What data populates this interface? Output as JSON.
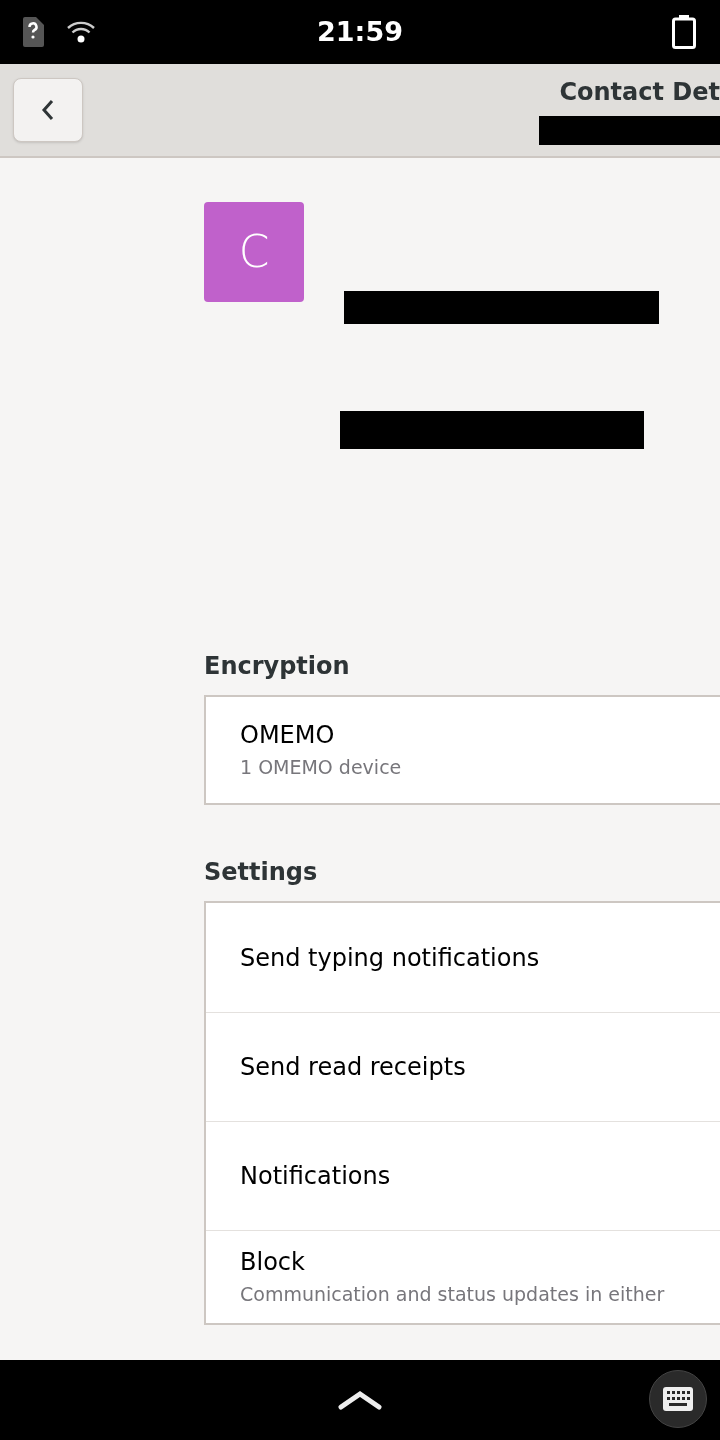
{
  "status_bar": {
    "time": "21:59"
  },
  "header": {
    "title": "Contact Det"
  },
  "contact": {
    "avatar_letter": "C"
  },
  "sections": [
    {
      "heading": "Encryption",
      "rows": [
        {
          "title": "OMEMO",
          "subtitle": "1 OMEMO device"
        }
      ]
    },
    {
      "heading": "Settings",
      "rows": [
        {
          "title": "Send typing notifications"
        },
        {
          "title": "Send read receipts"
        },
        {
          "title": "Notifications"
        },
        {
          "title": "Block",
          "subtitle": "Communication and status updates in either"
        }
      ]
    }
  ]
}
